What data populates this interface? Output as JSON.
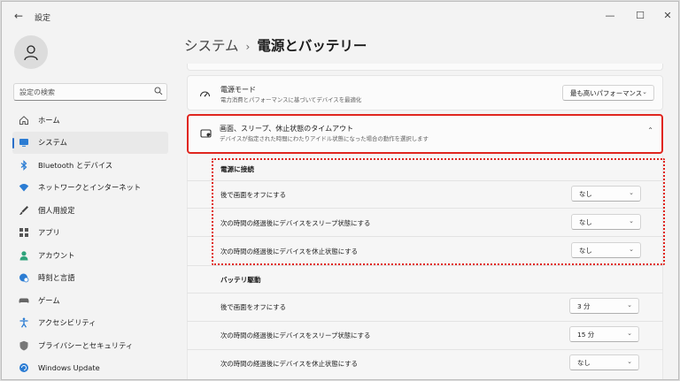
{
  "app_title": "設定",
  "window_controls": {
    "minimize": "—",
    "maximize": "☐",
    "close": "✕"
  },
  "search": {
    "placeholder": "設定の検索"
  },
  "sidebar": {
    "items": [
      {
        "label": "ホーム",
        "icon": "home-icon",
        "color": "#555555"
      },
      {
        "label": "システム",
        "icon": "system-icon",
        "color": "#2b7cd3",
        "active": true
      },
      {
        "label": "Bluetooth とデバイス",
        "icon": "bluetooth-icon",
        "color": "#2b7cd3"
      },
      {
        "label": "ネットワークとインターネット",
        "icon": "wifi-icon",
        "color": "#2b7cd3"
      },
      {
        "label": "個人用設定",
        "icon": "brush-icon",
        "color": "#444444"
      },
      {
        "label": "アプリ",
        "icon": "apps-icon",
        "color": "#555555"
      },
      {
        "label": "アカウント",
        "icon": "account-icon",
        "color": "#2fa37b"
      },
      {
        "label": "時刻と言語",
        "icon": "globe-clock-icon",
        "color": "#2b7cd3"
      },
      {
        "label": "ゲーム",
        "icon": "gamepad-icon",
        "color": "#666666"
      },
      {
        "label": "アクセシビリティ",
        "icon": "accessibility-icon",
        "color": "#2b7cd3"
      },
      {
        "label": "プライバシーとセキュリティ",
        "icon": "shield-icon",
        "color": "#777777"
      },
      {
        "label": "Windows Update",
        "icon": "update-icon",
        "color": "#2b7cd3"
      }
    ]
  },
  "breadcrumb": {
    "parent": "システム",
    "separator": "›",
    "current": "電源とバッテリー"
  },
  "power_mode": {
    "title": "電源モード",
    "description": "電力消費とパフォーマンスに基づいてデバイスを最適化",
    "value": "最も高いパフォーマンス"
  },
  "timeout": {
    "title": "画面、スリープ、休止状態のタイムアウト",
    "description": "デバイスが指定された時間にわたりアイドル状態になった場合の動作を選択します"
  },
  "plugged_in": {
    "heading": "電源に接続",
    "rows": [
      {
        "label": "後で画面をオフにする",
        "value": "なし"
      },
      {
        "label": "次の時間の経過後にデバイスをスリープ状態にする",
        "value": "なし"
      },
      {
        "label": "次の時間の経過後にデバイスを休止状態にする",
        "value": "なし"
      }
    ]
  },
  "battery": {
    "heading": "バッテリ駆動",
    "rows": [
      {
        "label": "後で画面をオフにする",
        "value": "3 分"
      },
      {
        "label": "次の時間の経過後にデバイスをスリープ状態にする",
        "value": "15 分"
      },
      {
        "label": "次の時間の経過後にデバイスを休止状態にする",
        "value": "なし"
      }
    ]
  },
  "highlight_color": "#e0261f",
  "accent_color": "#2b6fc8"
}
